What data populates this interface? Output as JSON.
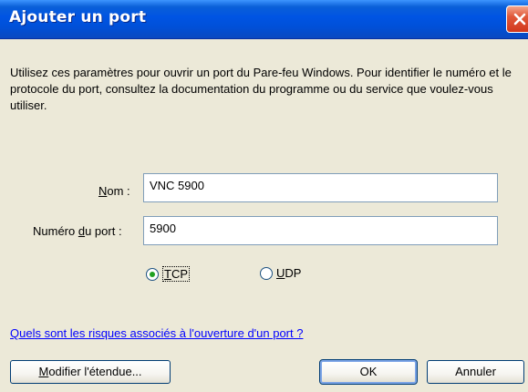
{
  "window": {
    "title": "Ajouter un port"
  },
  "description": "Utilisez ces paramètres pour ouvrir un port du Pare-feu Windows. Pour identifier le numéro et le protocole du port, consultez la documentation du programme ou du service que voulez-vous utiliser.",
  "fields": {
    "name": {
      "label_prefix": "",
      "label_accel": "N",
      "label_suffix": "om :",
      "value": "VNC 5900"
    },
    "port": {
      "label_prefix": "Numéro ",
      "label_accel": "d",
      "label_suffix": "u port :",
      "value": "5900"
    }
  },
  "protocol": {
    "selected": "TCP",
    "tcp": {
      "accel": "T",
      "rest": "CP"
    },
    "udp": {
      "accel": "U",
      "rest": "DP"
    }
  },
  "link": "Quels sont les risques associés à l'ouverture d'un port ?",
  "buttons": {
    "modify_scope": {
      "accel": "M",
      "rest": "odifier l'étendue..."
    },
    "ok": "OK",
    "cancel": "Annuler"
  },
  "colors": {
    "titlebar": "#0054e3",
    "dialog_bg": "#ece9d8",
    "link": "#0000ff",
    "close_button": "#d2371c",
    "radio_selected": "#21a121"
  },
  "icons": {
    "close": "close-icon"
  }
}
